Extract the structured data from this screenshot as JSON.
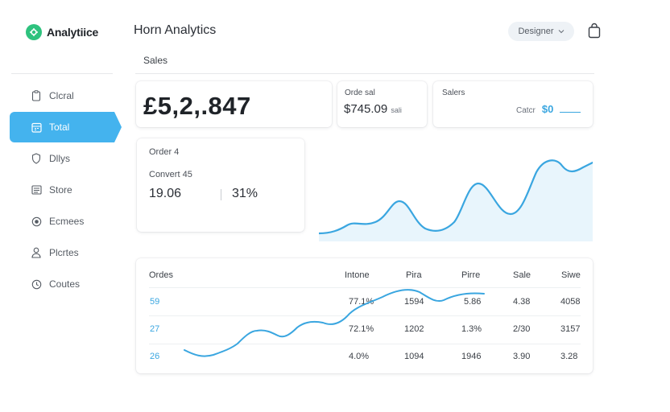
{
  "app": {
    "logo_text": "Analytiice",
    "title": "Horn Analytics"
  },
  "header": {
    "dropdown_label": "Designer",
    "dropdown_icon": "chevron-down-icon",
    "bag_icon": "shopping-bag-icon"
  },
  "sidebar": {
    "items": [
      {
        "label": "Clcral",
        "icon": "clipboard-icon",
        "active": false
      },
      {
        "label": "Total",
        "icon": "calendar-icon",
        "active": true
      },
      {
        "label": "Dllys",
        "icon": "shield-icon",
        "active": false
      },
      {
        "label": "Store",
        "icon": "list-icon",
        "active": false
      },
      {
        "label": "Ecmees",
        "icon": "record-icon",
        "active": false
      },
      {
        "label": "Plcrtes",
        "icon": "user-icon",
        "active": false
      },
      {
        "label": "Coutes",
        "icon": "clock-icon",
        "active": false
      }
    ]
  },
  "section": {
    "label": "Sales"
  },
  "kpi": {
    "total_value": "£5,2,.847",
    "order_label": "Orde sal",
    "order_value": "$745.09",
    "order_suffix": "sali",
    "sales_label": "Salers",
    "sales_sub_label": "Catcr",
    "sales_value": "$0"
  },
  "order_card": {
    "title": "Order 4",
    "convert_label": "Convert 45",
    "value_a": "19.06",
    "value_b": "31%"
  },
  "table": {
    "headers": [
      "Ordes",
      "Intone",
      "Pira",
      "Pirre",
      "Sale",
      "Siwe"
    ],
    "rows": [
      [
        "59",
        "77.1%",
        "1594",
        "5.86",
        "4.38",
        "4058"
      ],
      [
        "27",
        "72.1%",
        "1202",
        "1.3%",
        "2/30",
        "3157"
      ],
      [
        "26",
        "4.0%",
        "1094",
        "1946",
        "3.90",
        "3.28"
      ]
    ]
  },
  "colors": {
    "accent": "#44b3ee",
    "line": "#3aa6e0",
    "area": "#e8f5fc",
    "logo": "#2ec27e"
  }
}
